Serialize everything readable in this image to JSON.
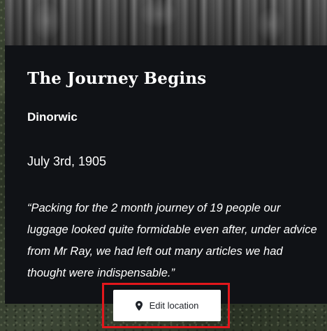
{
  "story": {
    "title": "The Journey Begins",
    "place": "Dinorwic",
    "date": "July 3rd, 1905",
    "quote": "“Packing for the 2 month journey of 19 people our luggage looked quite formidable even after, under advice from Mr Ray, we had left out many articles we had thought were indispensable.”"
  },
  "actions": {
    "edit_location_label": "Edit location",
    "edit_location_icon": "map-pin-icon"
  },
  "colors": {
    "card_background": "#101216",
    "highlight": "#e3171c",
    "button_background": "#ffffff",
    "text": "#ffffff"
  }
}
